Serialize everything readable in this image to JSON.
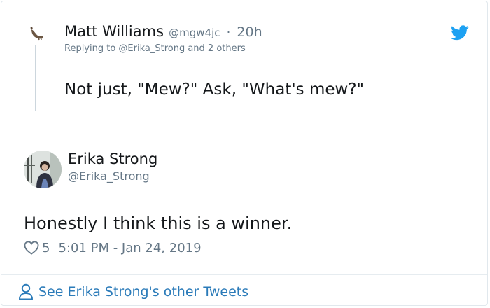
{
  "parent_tweet": {
    "author_name": "Matt Williams",
    "author_handle": "@mgw4jc",
    "separator": "·",
    "time": "20h",
    "replying_to": "Replying to @Erika_Strong and 2 others",
    "text": "Not just, \"Mew?\" Ask, \"What's mew?\""
  },
  "main_tweet": {
    "author_name": "Erika Strong",
    "author_handle": "@Erika_Strong",
    "text": "Honestly I think this is a winner.",
    "like_count": "5",
    "timestamp": "5:01 PM - Jan 24, 2019"
  },
  "footer": {
    "link_label": "See Erika Strong's other Tweets"
  },
  "colors": {
    "twitter_blue": "#1da1f2",
    "link_blue": "#2b7bb9",
    "secondary_text": "#657786",
    "thread_line": "#ccd6dd"
  },
  "icons": {
    "brand": "twitter-bird-icon",
    "like": "heart-icon",
    "footer": "person-icon"
  }
}
